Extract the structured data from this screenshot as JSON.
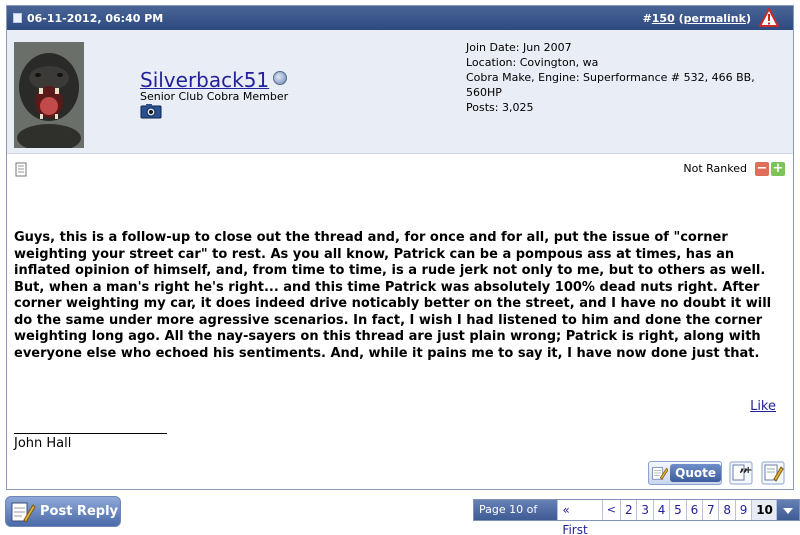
{
  "post": {
    "date": "06-11-2012, 06:40 PM",
    "number_prefix": "#",
    "number": "150",
    "permalink": "permalink",
    "permalink_open": "(",
    "permalink_close": ")"
  },
  "user": {
    "name": "Silverback51",
    "title": "Senior Club Cobra Member",
    "join_date": "Join Date: Jun 2007",
    "location": "Location: Covington, wa",
    "cobra_make": "Cobra Make, Engine: Superformance # 532, 466 BB, 560HP",
    "posts": "Posts: 3,025"
  },
  "rating": {
    "label": "Not Ranked",
    "minus": "−",
    "plus": "+"
  },
  "message": {
    "body": "Guys, this is a follow-up to close out the thread and, for once and for all, put the issue of \"corner weighting your street car\" to rest. As you all know, Patrick can be a pompous ass at times, has an inflated opinion of himself, and, from time to time, is a rude jerk not only to me, but to others as well. But, when a man's right he's right... and this time Patrick was absolutely 100% dead nuts right. After corner weighting my car, it does indeed drive noticably better on the street, and I have no doubt it will do the same under more agressive scenarios. In fact, I wish I had listened to him and done the corner weighting long ago. All the nay-sayers on this thread are just plain wrong; Patrick is right, along with everyone else who echoed his sentiments. And, while it pains me to say it, I have now done just that.",
    "like": "Like",
    "signature": "John Hall"
  },
  "actions": {
    "quote": "Quote",
    "post_reply": "Post Reply"
  },
  "pagination": {
    "info": "Page 10 of 10",
    "first": "« First",
    "prev": "<",
    "pages": [
      "2",
      "3",
      "4",
      "5",
      "6",
      "7",
      "8",
      "9"
    ],
    "current": "10"
  },
  "colors": {
    "header": "#2d4a80",
    "userbar": "#e9edf5",
    "link": "#22229c"
  }
}
